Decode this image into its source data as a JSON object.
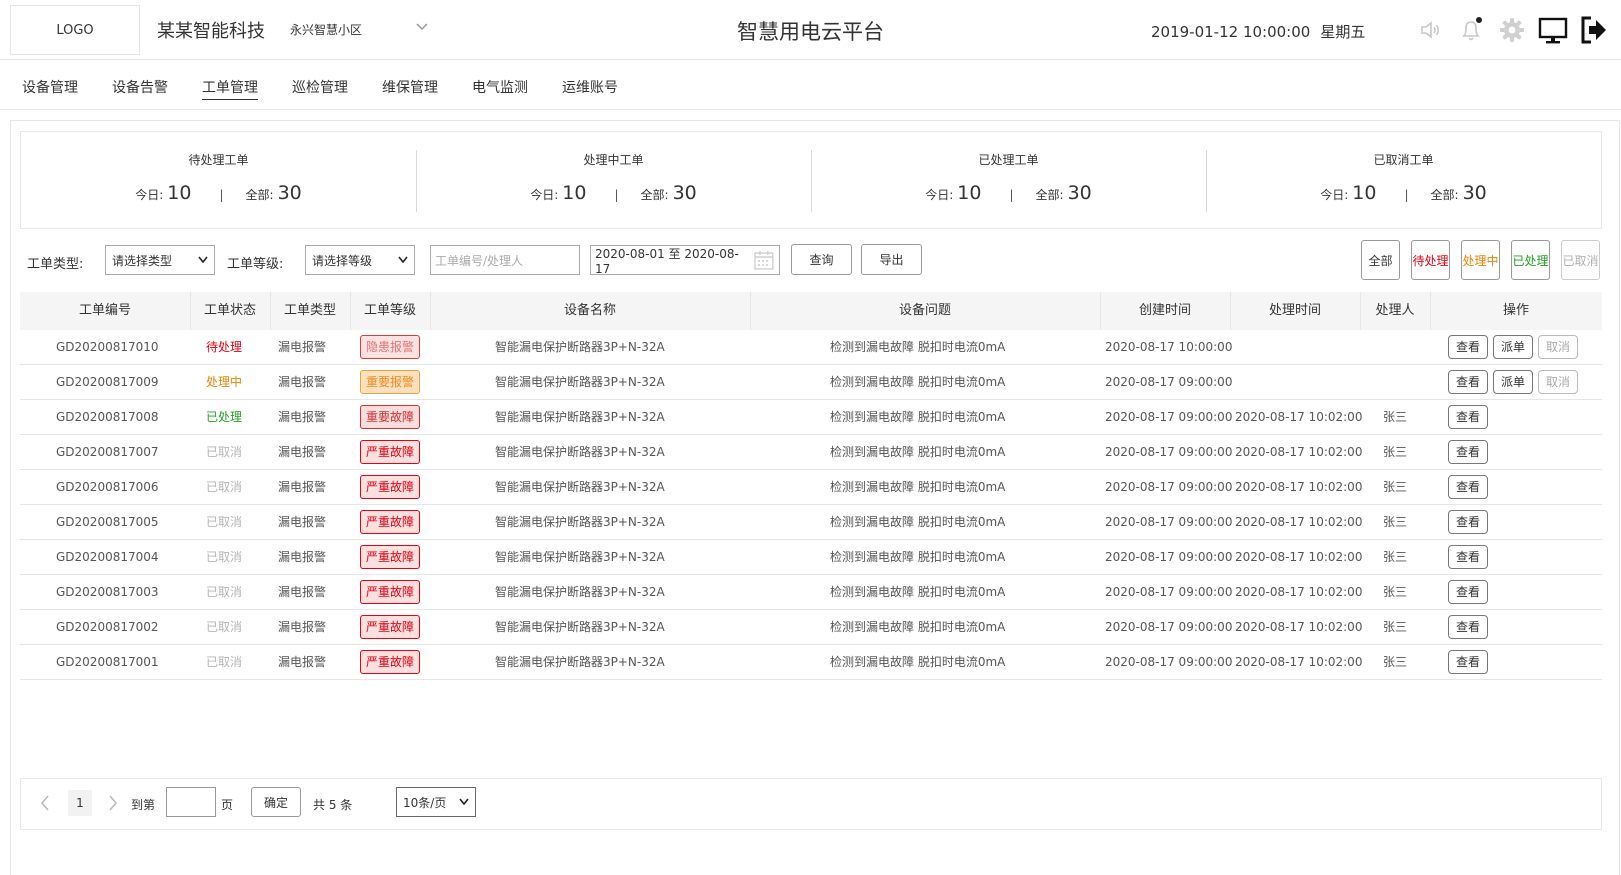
{
  "header": {
    "logo": "LOGO",
    "company": "某某智能科技",
    "community": "永兴智慧小区",
    "title": "智慧用电云平台",
    "date": "2019-01-12 10:00:00",
    "weekday": "星期五"
  },
  "nav": [
    "设备管理",
    "设备告警",
    "工单管理",
    "巡检管理",
    "维保管理",
    "电气监测",
    "运维账号"
  ],
  "stats": [
    {
      "title": "待处理工单",
      "today_label": "今日:",
      "today": "10",
      "sep": "|",
      "total_label": "全部:",
      "total": "30"
    },
    {
      "title": "处理中工单",
      "today_label": "今日:",
      "today": "10",
      "sep": "|",
      "total_label": "全部:",
      "total": "30"
    },
    {
      "title": "已处理工单",
      "today_label": "今日:",
      "today": "10",
      "sep": "|",
      "total_label": "全部:",
      "total": "30"
    },
    {
      "title": "已取消工单",
      "today_label": "今日:",
      "today": "10",
      "sep": "|",
      "total_label": "全部:",
      "total": "30"
    }
  ],
  "filters": {
    "type_label": "工单类型:",
    "type_value": "请选择类型",
    "level_label": "工单等级:",
    "level_value": "请选择等级",
    "search_placeholder": "工单编号/处理人",
    "date_range": "2020-08-01 至 2020-08-17",
    "query": "查询",
    "export": "导出"
  },
  "quick_filters": [
    {
      "label": "全部",
      "color": "#333333"
    },
    {
      "label": "待处理",
      "color": "#e60012"
    },
    {
      "label": "处理中",
      "color": "#f08200"
    },
    {
      "label": "已处理",
      "color": "#22a022"
    },
    {
      "label": "已取消",
      "color": "#b0b0b0"
    }
  ],
  "table": {
    "headers": [
      "工单编号",
      "工单状态",
      "工单类型",
      "工单等级",
      "设备名称",
      "设备问题",
      "创建时间",
      "处理时间",
      "处理人",
      "操作"
    ],
    "status_colors": {
      "待处理": "#e60012",
      "处理中": "#f08200",
      "已处理": "#22a022",
      "已取消": "#b5b5b5"
    },
    "level_colors": {
      "隐患报警": {
        "bg": "#fbe3e3",
        "border": "#e53935",
        "text": "#e57373"
      },
      "重要报警": {
        "bg": "#fde0bd",
        "border": "#f0a040",
        "text": "#f08c1e"
      },
      "重要故障": {
        "bg": "#f9dcdc",
        "border": "#d32f2f",
        "text": "#d32f2f"
      },
      "严重故障": {
        "bg": "#fbe0e0",
        "border": "#e60012",
        "text": "#e60012"
      }
    },
    "rows": [
      {
        "id": "GD20200817010",
        "status": "待处理",
        "type": "漏电报警",
        "level": "隐患报警",
        "device": "智能漏电保护断路器3P+N-32A",
        "issue": "检测到漏电故障 脱扣时电流0mA",
        "created": "2020-08-17 10:00:00",
        "handled": "",
        "handler": "",
        "actions": [
          {
            "label": "查看",
            "disabled": false
          },
          {
            "label": "派单",
            "disabled": false
          },
          {
            "label": "取消",
            "disabled": true
          }
        ]
      },
      {
        "id": "GD20200817009",
        "status": "处理中",
        "type": "漏电报警",
        "level": "重要报警",
        "device": "智能漏电保护断路器3P+N-32A",
        "issue": "检测到漏电故障 脱扣时电流0mA",
        "created": "2020-08-17 09:00:00",
        "handled": "",
        "handler": "",
        "actions": [
          {
            "label": "查看",
            "disabled": false
          },
          {
            "label": "派单",
            "disabled": false
          },
          {
            "label": "取消",
            "disabled": true
          }
        ]
      },
      {
        "id": "GD20200817008",
        "status": "已处理",
        "type": "漏电报警",
        "level": "重要故障",
        "device": "智能漏电保护断路器3P+N-32A",
        "issue": "检测到漏电故障 脱扣时电流0mA",
        "created": "2020-08-17 09:00:00",
        "handled": "2020-08-17 10:02:00",
        "handler": "张三",
        "actions": [
          {
            "label": "查看",
            "disabled": false
          }
        ]
      },
      {
        "id": "GD20200817007",
        "status": "已取消",
        "type": "漏电报警",
        "level": "严重故障",
        "device": "智能漏电保护断路器3P+N-32A",
        "issue": "检测到漏电故障 脱扣时电流0mA",
        "created": "2020-08-17 09:00:00",
        "handled": "2020-08-17 10:02:00",
        "handler": "张三",
        "actions": [
          {
            "label": "查看",
            "disabled": false
          }
        ]
      },
      {
        "id": "GD20200817006",
        "status": "已取消",
        "type": "漏电报警",
        "level": "严重故障",
        "device": "智能漏电保护断路器3P+N-32A",
        "issue": "检测到漏电故障 脱扣时电流0mA",
        "created": "2020-08-17 09:00:00",
        "handled": "2020-08-17 10:02:00",
        "handler": "张三",
        "actions": [
          {
            "label": "查看",
            "disabled": false
          }
        ]
      },
      {
        "id": "GD20200817005",
        "status": "已取消",
        "type": "漏电报警",
        "level": "严重故障",
        "device": "智能漏电保护断路器3P+N-32A",
        "issue": "检测到漏电故障 脱扣时电流0mA",
        "created": "2020-08-17 09:00:00",
        "handled": "2020-08-17 10:02:00",
        "handler": "张三",
        "actions": [
          {
            "label": "查看",
            "disabled": false
          }
        ]
      },
      {
        "id": "GD20200817004",
        "status": "已取消",
        "type": "漏电报警",
        "level": "严重故障",
        "device": "智能漏电保护断路器3P+N-32A",
        "issue": "检测到漏电故障 脱扣时电流0mA",
        "created": "2020-08-17 09:00:00",
        "handled": "2020-08-17 10:02:00",
        "handler": "张三",
        "actions": [
          {
            "label": "查看",
            "disabled": false
          }
        ]
      },
      {
        "id": "GD20200817003",
        "status": "已取消",
        "type": "漏电报警",
        "level": "严重故障",
        "device": "智能漏电保护断路器3P+N-32A",
        "issue": "检测到漏电故障 脱扣时电流0mA",
        "created": "2020-08-17 09:00:00",
        "handled": "2020-08-17 10:02:00",
        "handler": "张三",
        "actions": [
          {
            "label": "查看",
            "disabled": false
          }
        ]
      },
      {
        "id": "GD20200817002",
        "status": "已取消",
        "type": "漏电报警",
        "level": "严重故障",
        "device": "智能漏电保护断路器3P+N-32A",
        "issue": "检测到漏电故障 脱扣时电流0mA",
        "created": "2020-08-17 09:00:00",
        "handled": "2020-08-17 10:02:00",
        "handler": "张三",
        "actions": [
          {
            "label": "查看",
            "disabled": false
          }
        ]
      },
      {
        "id": "GD20200817001",
        "status": "已取消",
        "type": "漏电报警",
        "level": "严重故障",
        "device": "智能漏电保护断路器3P+N-32A",
        "issue": "检测到漏电故障 脱扣时电流0mA",
        "created": "2020-08-17 09:00:00",
        "handled": "2020-08-17 10:02:00",
        "handler": "张三",
        "actions": [
          {
            "label": "查看",
            "disabled": false
          }
        ]
      }
    ]
  },
  "pagination": {
    "current_page": "1",
    "goto_label": "到第",
    "page_unit": "页",
    "confirm": "确定",
    "total_text": "共 5 条",
    "page_size": "10条/页"
  }
}
